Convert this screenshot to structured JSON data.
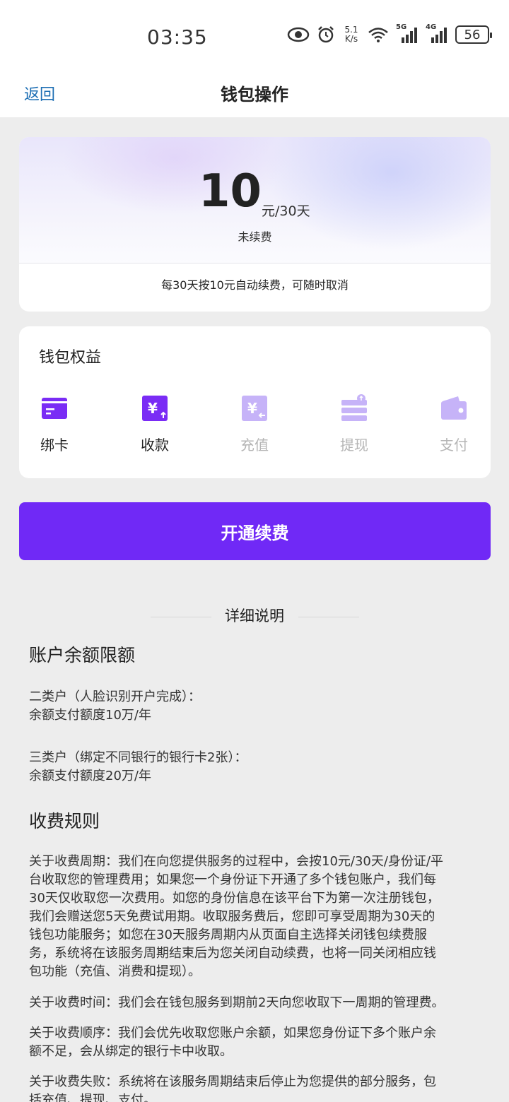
{
  "status_bar": {
    "time": "03:35",
    "net_speed_value": "5.1",
    "net_speed_unit": "K/s",
    "signal_1_label": "5G",
    "signal_2_label": "4G",
    "battery": "56",
    "icons": [
      "eye-icon",
      "alarm-icon",
      "wifi-icon",
      "signal-icon",
      "battery-icon"
    ]
  },
  "nav": {
    "back": "返回",
    "title": "钱包操作"
  },
  "price_card": {
    "amount": "10",
    "unit": "元/30天",
    "status": "未续费",
    "note": "每30天按10元自动续费，可随时取消"
  },
  "benefits": {
    "title": "钱包权益",
    "items": [
      {
        "label": "绑卡",
        "icon": "bind-card-icon",
        "enabled": true
      },
      {
        "label": "收款",
        "icon": "receive-payment-icon",
        "enabled": true
      },
      {
        "label": "充值",
        "icon": "recharge-icon",
        "enabled": false
      },
      {
        "label": "提现",
        "icon": "withdraw-icon",
        "enabled": false
      },
      {
        "label": "支付",
        "icon": "wallet-pay-icon",
        "enabled": false
      }
    ],
    "colors": {
      "enabled": "#7a2cf5",
      "disabled": "#c6b3f8"
    }
  },
  "open_button": {
    "label": "开通续费",
    "color": "#7029f6"
  },
  "details": {
    "heading": "详细说明",
    "sections": [
      {
        "title": "账户余额限额",
        "paragraphs": [
          [
            "二类户（人脸识别开户完成）：",
            "余额支付额度10万/年"
          ],
          [
            "三类户（绑定不同银行的银行卡2张）：",
            "余额支付额度20万/年"
          ]
        ]
      },
      {
        "title": "收费规则",
        "paragraphs": [
          [
            "关于收费周期：我们在向您提供服务的过程中，会按10元/30天/身份证/平",
            "台收取您的管理费用；如果您一个身份证下开通了多个钱包账户，我们每",
            "30天仅收取您一次费用。如您的身份信息在该平台下为第一次注册钱包，",
            "我们会赠送您5天免费试用期。收取服务费后，您即可享受周期为30天的",
            "钱包功能服务；如您在30天服务周期内从页面自主选择关闭钱包续费服",
            "务，系统将在该服务周期结束后为您关闭自动续费，也将一同关闭相应钱",
            "包功能（充值、消费和提现）。"
          ],
          [
            "关于收费时间：我们会在钱包服务到期前2天向您收取下一周期的管理费。"
          ],
          [
            "关于收费顺序：我们会优先收取您账户余额，如果您身份证下多个账户余",
            "额不足，会从绑定的银行卡中收取。"
          ],
          [
            "关于收费失败：系统将在该服务周期结束后停止为您提供的部分服务，包",
            "括充值、提现、支付。"
          ]
        ]
      }
    ]
  }
}
